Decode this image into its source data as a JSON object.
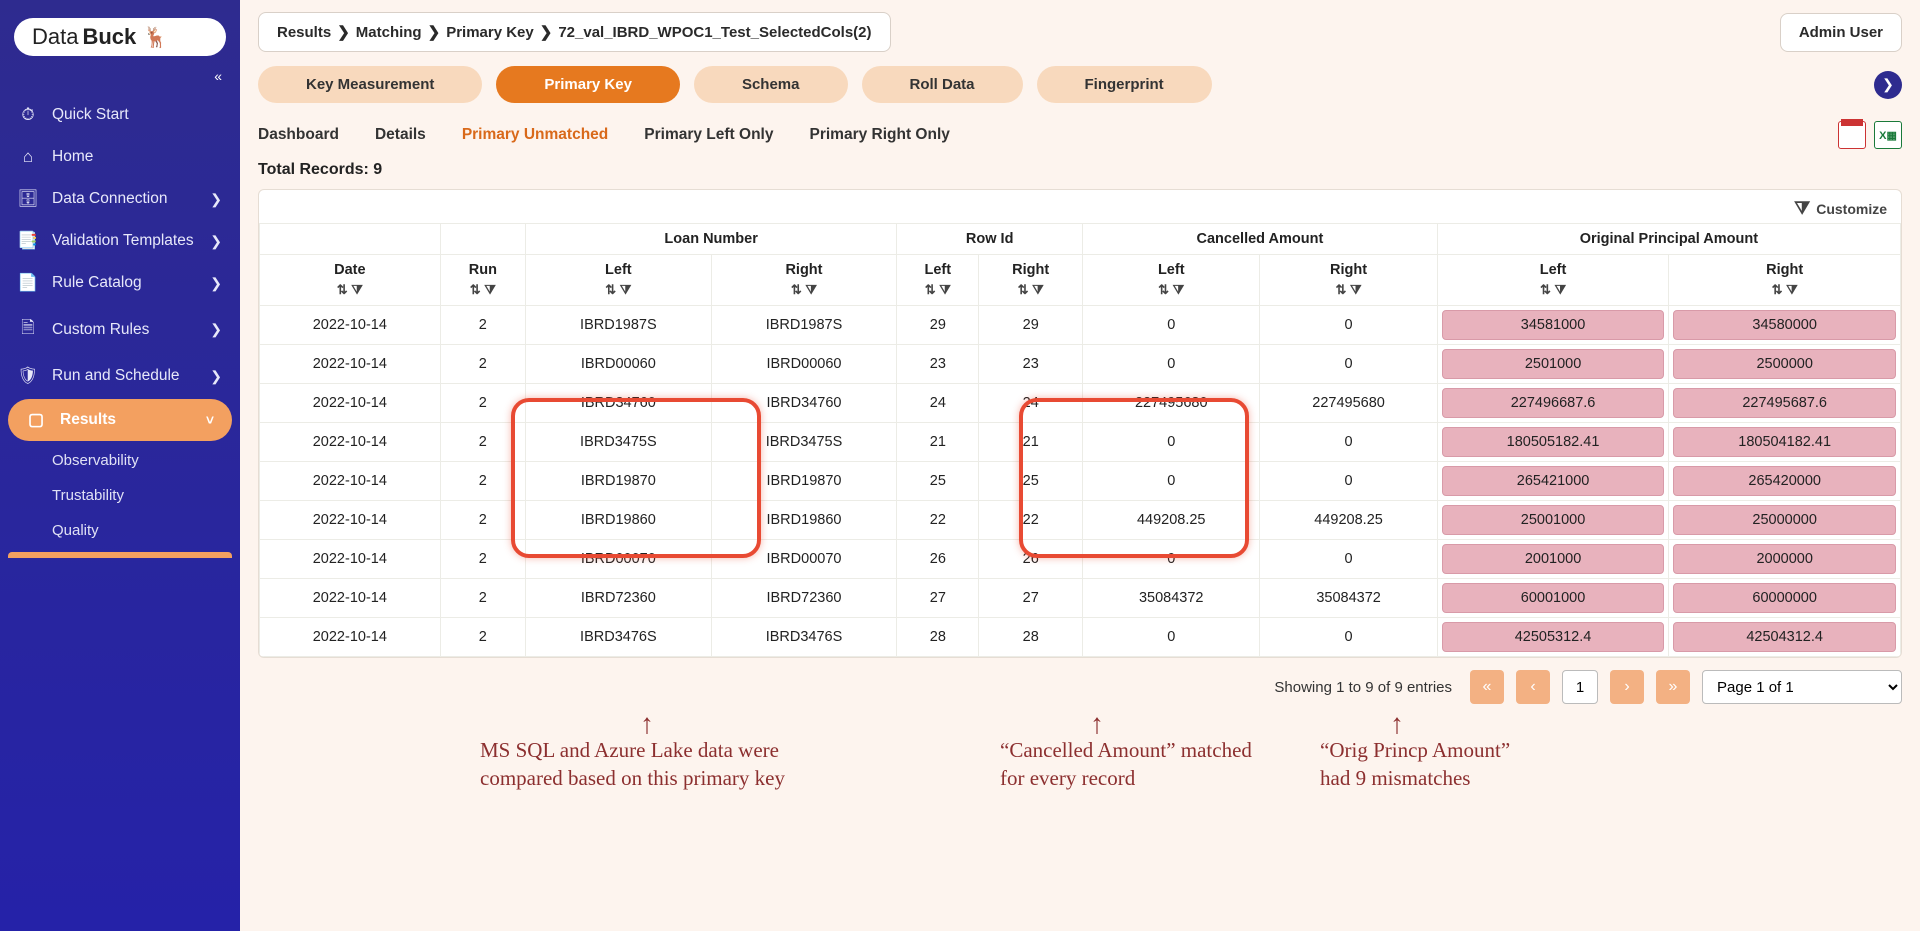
{
  "brand": {
    "p1": "Data",
    "p2": "Buck"
  },
  "user": "Admin User",
  "breadcrumb": [
    "Results",
    "Matching",
    "Primary Key",
    "72_val_IBRD_WPOC1_Test_SelectedCols(2)"
  ],
  "sidebar": {
    "items": [
      {
        "icon": "⏱",
        "label": "Quick Start",
        "chev": false
      },
      {
        "icon": "⌂",
        "label": "Home",
        "chev": false
      },
      {
        "icon": "🗄",
        "label": "Data Connection",
        "chev": true
      },
      {
        "icon": "📑",
        "label": "Validation Templates",
        "chev": true
      },
      {
        "icon": "📄",
        "label": "Rule Catalog",
        "chev": true
      },
      {
        "icon": "🗎",
        "label": "Custom Rules",
        "chev": true
      },
      {
        "icon": "🛡",
        "label": "Run and Schedule",
        "chev": true
      },
      {
        "icon": "▢",
        "label": "Results",
        "chev": true,
        "active": true
      }
    ],
    "subs": [
      "Observability",
      "Trustability",
      "Quality"
    ]
  },
  "pills": [
    "Key Measurement",
    "Primary Key",
    "Schema",
    "Roll Data",
    "Fingerprint"
  ],
  "activePill": 1,
  "subtabs": [
    "Dashboard",
    "Details",
    "Primary Unmatched",
    "Primary Left Only",
    "Primary Right Only"
  ],
  "activeSubtab": 2,
  "totalLabel": "Total Records:",
  "totalValue": "9",
  "customize": "Customize",
  "groupHeaders": [
    "",
    "",
    "Loan Number",
    "Row Id",
    "Cancelled Amount",
    "Original Principal Amount"
  ],
  "colHeaders": [
    "Date",
    "Run",
    "Left",
    "Right",
    "Left",
    "Right",
    "Left",
    "Right",
    "Left",
    "Right"
  ],
  "rows": [
    {
      "date": "2022-10-14",
      "run": "2",
      "lnL": "IBRD1987S",
      "lnR": "IBRD1987S",
      "ridL": "29",
      "ridR": "29",
      "caL": "0",
      "caR": "0",
      "opL": "34581000",
      "opR": "34580000"
    },
    {
      "date": "2022-10-14",
      "run": "2",
      "lnL": "IBRD00060",
      "lnR": "IBRD00060",
      "ridL": "23",
      "ridR": "23",
      "caL": "0",
      "caR": "0",
      "opL": "2501000",
      "opR": "2500000"
    },
    {
      "date": "2022-10-14",
      "run": "2",
      "lnL": "IBRD34760",
      "lnR": "IBRD34760",
      "ridL": "24",
      "ridR": "24",
      "caL": "227495680",
      "caR": "227495680",
      "opL": "227496687.6",
      "opR": "227495687.6"
    },
    {
      "date": "2022-10-14",
      "run": "2",
      "lnL": "IBRD3475S",
      "lnR": "IBRD3475S",
      "ridL": "21",
      "ridR": "21",
      "caL": "0",
      "caR": "0",
      "opL": "180505182.41",
      "opR": "180504182.41"
    },
    {
      "date": "2022-10-14",
      "run": "2",
      "lnL": "IBRD19870",
      "lnR": "IBRD19870",
      "ridL": "25",
      "ridR": "25",
      "caL": "0",
      "caR": "0",
      "opL": "265421000",
      "opR": "265420000"
    },
    {
      "date": "2022-10-14",
      "run": "2",
      "lnL": "IBRD19860",
      "lnR": "IBRD19860",
      "ridL": "22",
      "ridR": "22",
      "caL": "449208.25",
      "caR": "449208.25",
      "opL": "25001000",
      "opR": "25000000"
    },
    {
      "date": "2022-10-14",
      "run": "2",
      "lnL": "IBRD00070",
      "lnR": "IBRD00070",
      "ridL": "26",
      "ridR": "26",
      "caL": "0",
      "caR": "0",
      "opL": "2001000",
      "opR": "2000000"
    },
    {
      "date": "2022-10-14",
      "run": "2",
      "lnL": "IBRD72360",
      "lnR": "IBRD72360",
      "ridL": "27",
      "ridR": "27",
      "caL": "35084372",
      "caR": "35084372",
      "opL": "60001000",
      "opR": "60000000"
    },
    {
      "date": "2022-10-14",
      "run": "2",
      "lnL": "IBRD3476S",
      "lnR": "IBRD3476S",
      "ridL": "28",
      "ridR": "28",
      "caL": "0",
      "caR": "0",
      "opL": "42505312.4",
      "opR": "42504312.4"
    }
  ],
  "footer": {
    "info": "Showing 1 to 9 of 9 entries",
    "page": "1",
    "pageSelect": "Page 1 of 1"
  },
  "annotations": {
    "a1": "MS SQL and Azure Lake data were compared based on this primary key",
    "a2": "“Cancelled Amount” matched for every record",
    "a3": "“Orig Princp Amount” had 9 mismatches"
  }
}
